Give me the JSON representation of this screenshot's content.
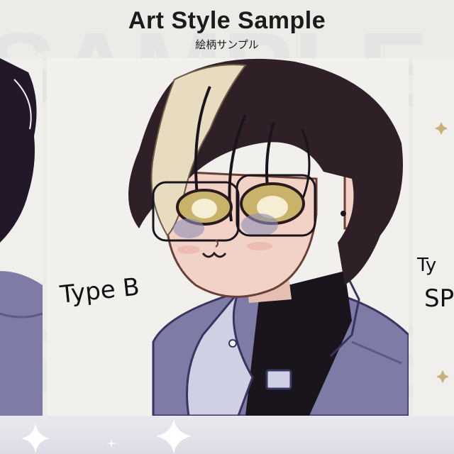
{
  "header": {
    "title": "Art Style Sample",
    "subtitle": "絵柄サンプル"
  },
  "center_panel": {
    "label": "Type B"
  },
  "right_panel": {
    "label_line1": "Ty",
    "label_line2": "SP"
  },
  "watermark_text": "SAMPLE",
  "colors": {
    "background": "#ecebe8",
    "jacket": "#7e7ba6",
    "hair_dark": "#2f2028",
    "hair_light": "#e8dcc0",
    "skin": "#f2d2c6",
    "eyes": "#c9b36a"
  },
  "icons": [
    "sparkle-icon"
  ]
}
